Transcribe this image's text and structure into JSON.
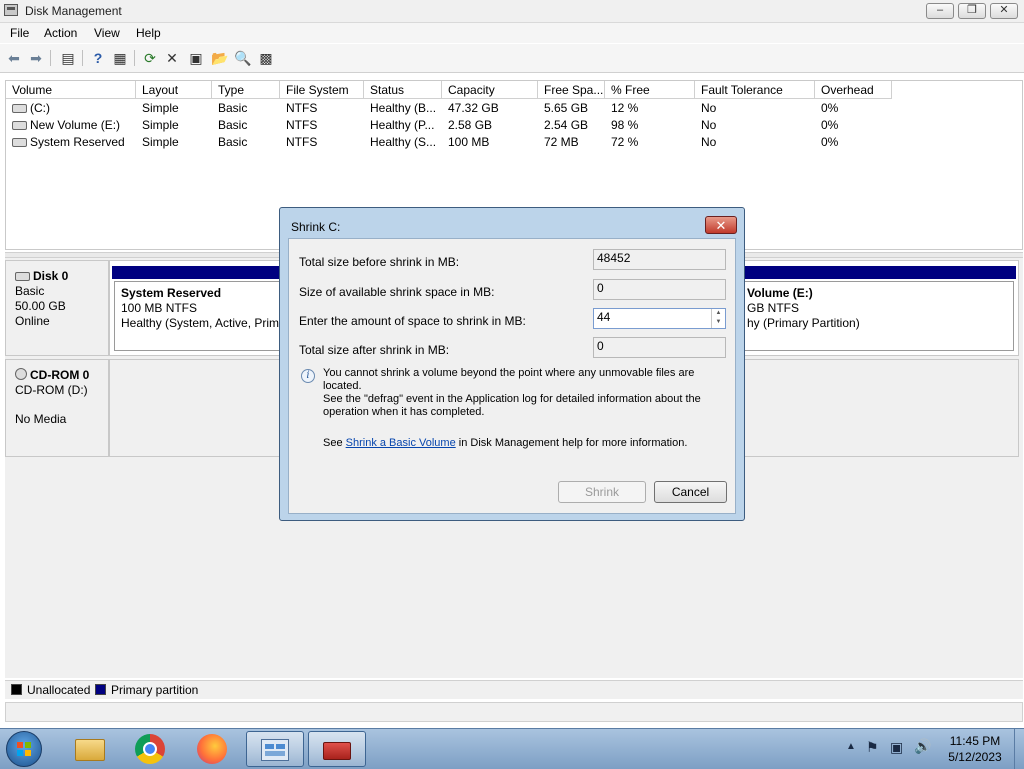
{
  "window": {
    "title": "Disk Management"
  },
  "menu": [
    "File",
    "Action",
    "View",
    "Help"
  ],
  "volume_list": {
    "columns": [
      "Volume",
      "Layout",
      "Type",
      "File System",
      "Status",
      "Capacity",
      "Free Spa...",
      "% Free",
      "Fault Tolerance",
      "Overhead"
    ],
    "rows": [
      [
        "(C:)",
        "Simple",
        "Basic",
        "NTFS",
        "Healthy (B...",
        "47.32 GB",
        "5.65 GB",
        "12 %",
        "No",
        "0%"
      ],
      [
        "New Volume (E:)",
        "Simple",
        "Basic",
        "NTFS",
        "Healthy (P...",
        "2.58 GB",
        "2.54 GB",
        "98 %",
        "No",
        "0%"
      ],
      [
        "System Reserved",
        "Simple",
        "Basic",
        "NTFS",
        "Healthy (S...",
        "100 MB",
        "72 MB",
        "72 %",
        "No",
        "0%"
      ]
    ]
  },
  "disks": {
    "disk0": {
      "name": "Disk 0",
      "type": "Basic",
      "size": "50.00 GB",
      "state": "Online",
      "partitions": [
        {
          "title": "System Reserved",
          "line1": "100 MB NTFS",
          "line2": "Healthy (System, Active, Prima"
        },
        {
          "title": "Volume  (E:)",
          "line1": "GB NTFS",
          "line2": "hy (Primary Partition)"
        }
      ]
    },
    "cdrom0": {
      "name": "CD-ROM 0",
      "type": "CD-ROM (D:)",
      "media": "No Media"
    }
  },
  "legend": {
    "unallocated": "Unallocated",
    "primary": "Primary partition",
    "unallocated_color": "#000000",
    "primary_color": "#000080"
  },
  "dialog": {
    "title": "Shrink C:",
    "close_symbol": "✕",
    "fields": {
      "total_before_label": "Total size before shrink in MB:",
      "total_before_value": "48452",
      "available_label": "Size of available shrink space in MB:",
      "available_value": "0",
      "amount_label": "Enter the amount of space to shrink in MB:",
      "amount_value": "44",
      "total_after_label": "Total size after shrink in MB:",
      "total_after_value": "0"
    },
    "info_text_1": "You cannot shrink a volume beyond the point where any unmovable files are located.",
    "info_text_2": "See the \"defrag\" event in the Application log for detailed information about the",
    "info_text_3": "operation when it has completed.",
    "help_prefix": "See ",
    "help_link": "Shrink a Basic Volume",
    "help_suffix": " in Disk Management help for more information.",
    "shrink_button": "Shrink",
    "cancel_button": "Cancel"
  },
  "taskbar": {
    "clock_time": "11:45 PM",
    "clock_date": "5/12/2023",
    "apps": [
      "start-orb",
      "file-explorer",
      "chrome",
      "firefox",
      "computer-management",
      "toolbox"
    ]
  },
  "toolbar_icons": [
    "back-arrow-icon",
    "forward-arrow-icon",
    "console-tree-icon",
    "help-icon",
    "properties-icon",
    "refresh-icon",
    "delete-icon",
    "properties-page-icon",
    "open-icon",
    "search-icon",
    "settings-icon"
  ]
}
